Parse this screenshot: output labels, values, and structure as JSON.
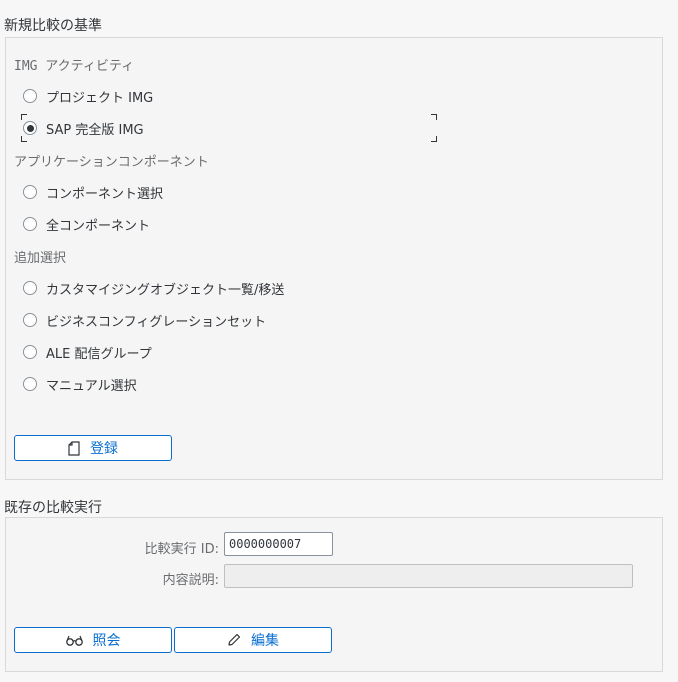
{
  "new_comparison": {
    "title": "新規比較の基準",
    "img_group_label": "IMG アクティビティ",
    "img_options": [
      {
        "label": "プロジェクト IMG",
        "selected": false
      },
      {
        "label": "SAP 完全版 IMG",
        "selected": true
      }
    ],
    "component_group_label": "アプリケーションコンポーネント",
    "component_options": [
      {
        "label": "コンポーネント選択",
        "selected": false
      },
      {
        "label": "全コンポーネント",
        "selected": false
      }
    ],
    "additional_group_label": "追加選択",
    "additional_options": [
      {
        "label": "カスタマイジングオブジェクト一覧/移送",
        "selected": false
      },
      {
        "label": "ビジネスコンフィグレーションセット",
        "selected": false
      },
      {
        "label": "ALE 配信グループ",
        "selected": false
      },
      {
        "label": "マニュアル選択",
        "selected": false
      }
    ],
    "register_button": "登録"
  },
  "existing_runs": {
    "title": "既存の比較実行",
    "run_id_label": "比較実行 ID:",
    "run_id_value": "0000000007",
    "description_label": "内容説明:",
    "description_value": "",
    "display_button": "照会",
    "edit_button": "編集"
  },
  "colors": {
    "accent": "#0a6ed1",
    "text": "#32363a",
    "label": "#6a6d70",
    "border": "#d9d9d9"
  }
}
